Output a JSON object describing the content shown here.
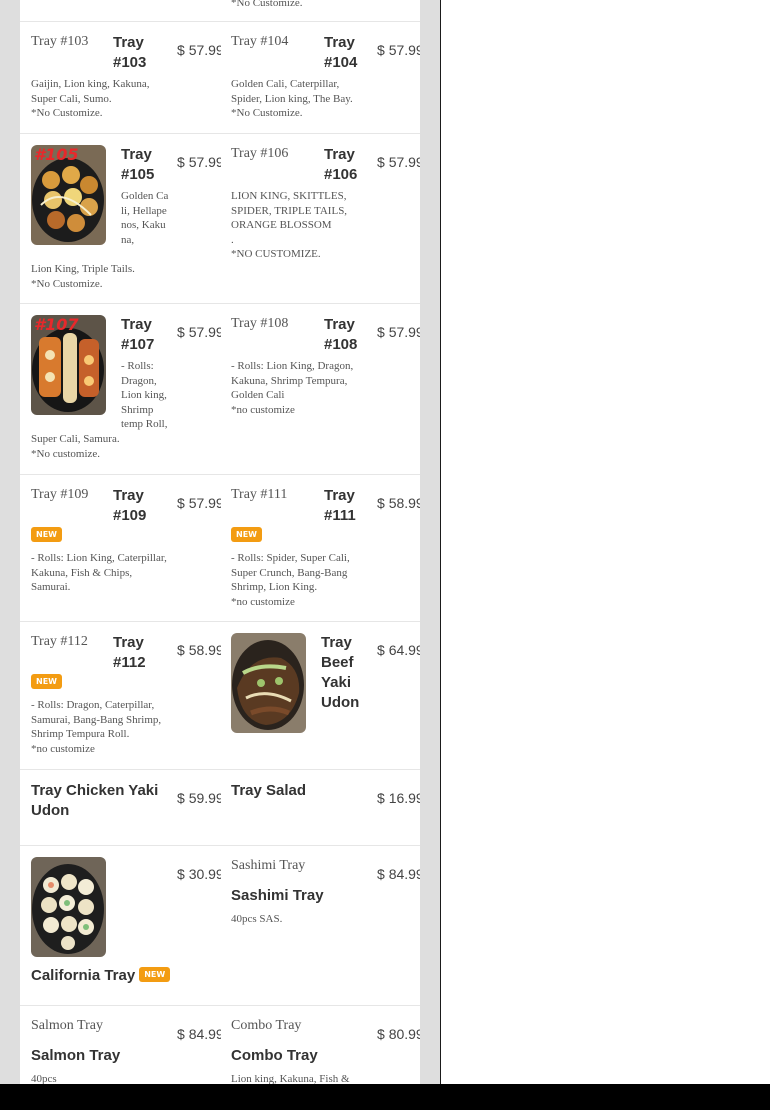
{
  "top_row": {
    "note": "*No Customize."
  },
  "currency": "$",
  "badge": "NEW",
  "items": {
    "tray103": {
      "alt": "Tray #103",
      "name": "Tray #103",
      "price": "57.99",
      "desc": "Gaijin, Lion king, Kakuna, Super Cali, Sumo.",
      "note": "*No Customize."
    },
    "tray104": {
      "alt": "Tray #104",
      "name": "Tray #104",
      "price": "57.99",
      "desc": "Golden Cali, Caterpillar, Spider, Lion king, The Bay.",
      "note": "*No Customize."
    },
    "tray105": {
      "name": "Tray #105",
      "price": "57.99",
      "image_label": "#105",
      "desc": "Golden Cali, Hellapenos, Kakuna, Lion King, Triple Tails.",
      "note": "*No Customize."
    },
    "tray106": {
      "alt": "Tray #106",
      "name": "Tray #106",
      "price": "57.99",
      "desc": "LION KING, SKITTLES, SPIDER, TRIPLE TAILS, ORANGE BLOSSOM",
      "dot": ".",
      "note": "*NO CUSTOMIZE."
    },
    "tray107": {
      "name": "Tray #107",
      "price": "57.99",
      "image_label": "#107",
      "desc": "- Rolls: Dragon, Lion king, Shrimp temp Roll, Super Cali, Samura.",
      "note": "*No customize."
    },
    "tray108": {
      "alt": "Tray #108",
      "name": "Tray #108",
      "price": "57.99",
      "desc": "- Rolls: Lion King, Dragon, Kakuna, Shrimp Tempura, Golden Cali",
      "note": "*no customize"
    },
    "tray109": {
      "alt": "Tray #109",
      "name": "Tray #109",
      "price": "57.99",
      "desc": "- Rolls: Lion King, Caterpillar, Kakuna, Fish & Chips, Samurai."
    },
    "tray111": {
      "alt": "Tray #111",
      "name": "Tray #111",
      "price": "58.99",
      "desc": "- Rolls: Spider, Super Cali, Super Crunch, Bang-Bang Shrimp, Lion King.",
      "note": "*no customize"
    },
    "tray112": {
      "alt": "Tray #112",
      "name": "Tray #112",
      "price": "58.99",
      "desc": "- Rolls: Dragon, Caterpillar, Samurai, Bang-Bang Shrimp, Shrimp Tempura Roll.",
      "note": "*no customize"
    },
    "beef_udon": {
      "name": "Tray Beef Yaki Udon",
      "price": "64.99"
    },
    "chicken_udon": {
      "name": "Tray Chicken Yaki Udon",
      "price": "59.99"
    },
    "salad": {
      "name": "Tray Salad",
      "price": "16.99"
    },
    "california": {
      "name": "California Tray",
      "price": "30.99"
    },
    "sashimi": {
      "alt": "Sashimi Tray",
      "name": "Sashimi Tray",
      "price": "84.99",
      "desc": "40pcs SAS."
    },
    "salmon": {
      "alt": "Salmon Tray",
      "name": "Salmon Tray",
      "price": "84.99",
      "desc": "40pcs"
    },
    "combo": {
      "alt": "Combo Tray",
      "name": "Combo Tray",
      "price": "80.99",
      "desc": "Lion king, Kakuna, Fish &"
    }
  },
  "colors": {
    "badge": "#f39c12",
    "page_bg": "#dedede",
    "card_bg": "#ffffff",
    "tray_label": "#e8282b"
  }
}
